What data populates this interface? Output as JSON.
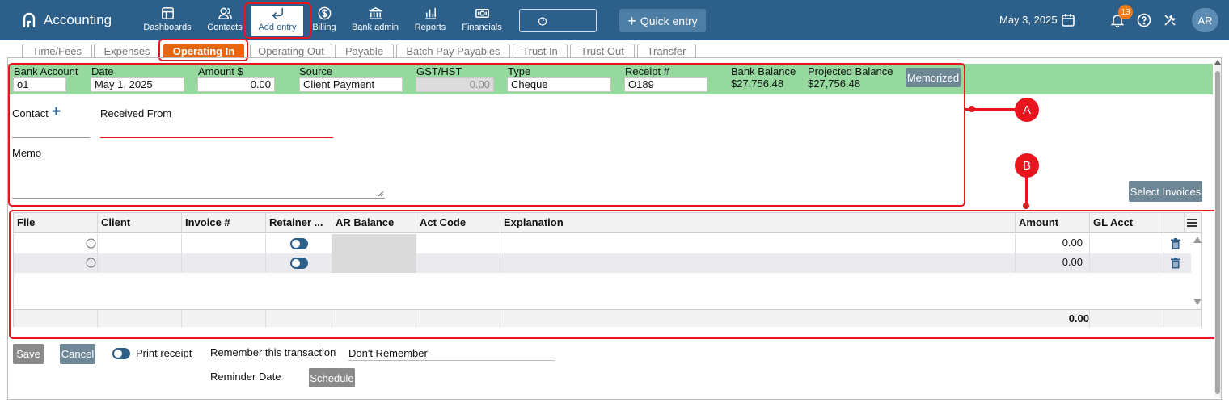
{
  "app": {
    "title": "Accounting"
  },
  "nav": [
    {
      "label": "Dashboards",
      "icon": "dashboard-icon"
    },
    {
      "label": "Contacts",
      "icon": "contacts-icon"
    },
    {
      "label": "Add entry",
      "icon": "add-entry-icon"
    },
    {
      "label": "Billing",
      "icon": "billing-icon"
    },
    {
      "label": "Bank admin",
      "icon": "bank-icon"
    },
    {
      "label": "Reports",
      "icon": "reports-icon"
    },
    {
      "label": "Financials",
      "icon": "financials-icon"
    }
  ],
  "topbar": {
    "quick_entry": "Quick entry",
    "date": "May 3, 2025",
    "notifications": "13",
    "avatar": "AR"
  },
  "tabs": [
    "Time/Fees",
    "Expenses",
    "Operating In",
    "Operating Out",
    "Payable",
    "Batch Pay Payables",
    "Trust In",
    "Trust Out",
    "Transfer"
  ],
  "form": {
    "bank_account": {
      "label": "Bank Account",
      "value": "o1"
    },
    "date": {
      "label": "Date",
      "value": "May 1, 2025"
    },
    "amount": {
      "label": "Amount $",
      "value": "0.00"
    },
    "source": {
      "label": "Source",
      "value": "Client Payment"
    },
    "gst": {
      "label": "GST/HST",
      "value": "0.00"
    },
    "type": {
      "label": "Type",
      "value": "Cheque"
    },
    "receipt": {
      "label": "Receipt #",
      "value": "O189"
    },
    "bank_balance": {
      "label": "Bank Balance",
      "value": "$27,756.48"
    },
    "projected_balance": {
      "label": "Projected Balance",
      "value": "$27,756.48"
    },
    "memorized": "Memorized",
    "contact_label": "Contact",
    "received_from_label": "Received From",
    "memo_label": "Memo",
    "select_invoices": "Select Invoices"
  },
  "grid": {
    "columns": [
      "File",
      "Client",
      "Invoice #",
      "Retainer ...",
      "AR Balance",
      "Act Code",
      "Explanation",
      "Amount",
      "GL Acct"
    ],
    "rows": [
      {
        "amount": "0.00"
      },
      {
        "amount": "0.00"
      }
    ],
    "total": "0.00"
  },
  "footer": {
    "save": "Save",
    "cancel": "Cancel",
    "print_receipt": "Print receipt",
    "remember_label": "Remember this transaction",
    "remember_value": "Don't Remember",
    "reminder_label": "Reminder Date",
    "schedule": "Schedule"
  },
  "callouts": {
    "a": "A",
    "b": "B"
  },
  "colors": {
    "topbar": "#2c5f8a",
    "active_tab": "#e8660f",
    "green_band": "#95d99e",
    "highlight": "#e8141e"
  }
}
